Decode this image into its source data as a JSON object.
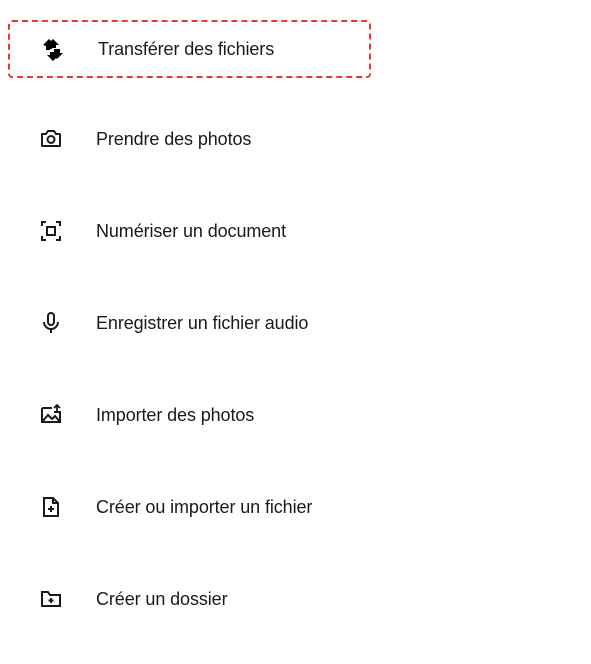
{
  "menu": {
    "items": [
      {
        "label": "Transférer des fichiers",
        "icon": "transfer-icon",
        "highlighted": true
      },
      {
        "label": "Prendre des photos",
        "icon": "camera-icon",
        "highlighted": false
      },
      {
        "label": "Numériser un document",
        "icon": "scan-icon",
        "highlighted": false
      },
      {
        "label": "Enregistrer un fichier audio",
        "icon": "microphone-icon",
        "highlighted": false
      },
      {
        "label": "Importer des photos",
        "icon": "import-photos-icon",
        "highlighted": false
      },
      {
        "label": "Créer ou importer un fichier",
        "icon": "create-file-icon",
        "highlighted": false
      },
      {
        "label": "Créer un dossier",
        "icon": "create-folder-icon",
        "highlighted": false
      }
    ]
  }
}
